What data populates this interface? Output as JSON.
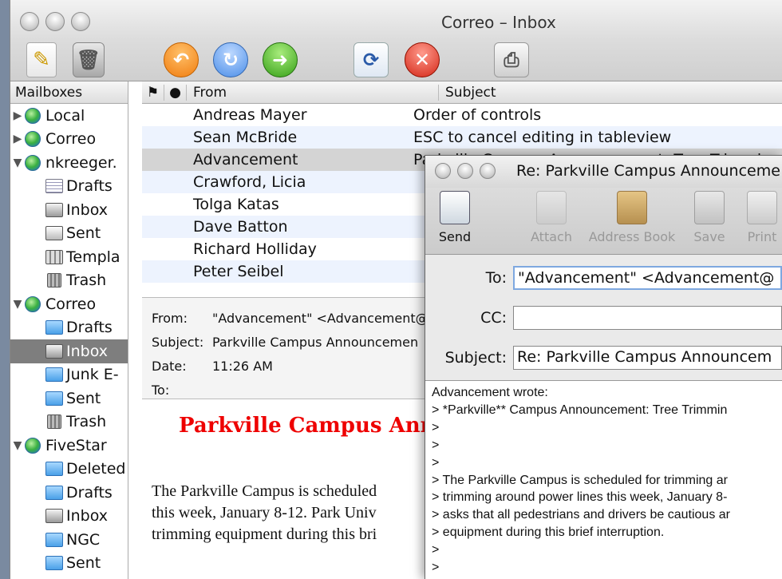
{
  "window": {
    "title": "Correo – Inbox"
  },
  "toolbar": {
    "compose_icon": "pencil-notepad-icon",
    "trash_icon": "trash-can-icon",
    "reply_icon": "reply-arrow-icon",
    "reply_all_icon": "reply-all-arrow-icon",
    "forward_icon": "forward-arrow-icon",
    "sync_icon": "sync-icon",
    "delete_icon": "delete-x-icon",
    "print_icon": "printer-icon"
  },
  "sidebar": {
    "header": "Mailboxes",
    "items": [
      {
        "label": "Local",
        "level": 0,
        "icon": "globe-icon",
        "expanded": false
      },
      {
        "label": "Correo",
        "level": 0,
        "icon": "globe-icon",
        "expanded": false
      },
      {
        "label": "nkreeger.",
        "level": 0,
        "icon": "globe-icon",
        "expanded": true
      },
      {
        "label": "Drafts",
        "level": 1,
        "icon": "drafts-icon"
      },
      {
        "label": "Inbox",
        "level": 1,
        "icon": "inbox-icon"
      },
      {
        "label": "Sent",
        "level": 1,
        "icon": "sent-icon"
      },
      {
        "label": "Templa",
        "level": 1,
        "icon": "templates-icon"
      },
      {
        "label": "Trash",
        "level": 1,
        "icon": "trash-icon"
      },
      {
        "label": "Correo",
        "level": 0,
        "icon": "globe-icon",
        "expanded": true
      },
      {
        "label": "Drafts",
        "level": 1,
        "icon": "folder-icon"
      },
      {
        "label": "Inbox",
        "level": 1,
        "icon": "inbox-icon",
        "selected": true
      },
      {
        "label": "Junk E-",
        "level": 1,
        "icon": "folder-icon"
      },
      {
        "label": "Sent",
        "level": 1,
        "icon": "folder-icon"
      },
      {
        "label": "Trash",
        "level": 1,
        "icon": "trash-icon"
      },
      {
        "label": "FiveStar",
        "level": 0,
        "icon": "globe-icon",
        "expanded": true
      },
      {
        "label": "Deleted",
        "level": 1,
        "icon": "folder-icon"
      },
      {
        "label": "Drafts",
        "level": 1,
        "icon": "folder-icon"
      },
      {
        "label": "Inbox",
        "level": 1,
        "icon": "inbox-icon"
      },
      {
        "label": "NGC",
        "level": 1,
        "icon": "folder-icon"
      },
      {
        "label": "Sent",
        "level": 1,
        "icon": "folder-icon"
      }
    ]
  },
  "message_list": {
    "columns": {
      "flag": "⚑",
      "read": "●",
      "from": "From",
      "subject": "Subject"
    },
    "rows": [
      {
        "from": "Andreas Mayer",
        "subject": "Order of controls"
      },
      {
        "from": "Sean McBride",
        "subject": "ESC to cancel editing in tableview"
      },
      {
        "from": "Advancement",
        "subject": "Parkville Campus Announcement: Tree Trimming",
        "selected": true
      },
      {
        "from": "Crawford, Licia",
        "subject": ""
      },
      {
        "from": "Tolga Katas",
        "subject": ""
      },
      {
        "from": "Dave Batton",
        "subject": ""
      },
      {
        "from": "Richard Holliday",
        "subject": ""
      },
      {
        "from": "Peter Seibel",
        "subject": ""
      }
    ]
  },
  "preview": {
    "headers": {
      "from_label": "From:",
      "from_value": "\"Advancement\" <Advancement@",
      "subject_label": "Subject:",
      "subject_value": "Parkville Campus Announcemen",
      "date_label": "Date:",
      "date_value": "11:26 AM",
      "to_label": "To:",
      "to_value": ""
    },
    "heading": "Parkville Campus Ann",
    "body": "The Parkville Campus is scheduled\nthis week, January 8-12. Park Univ\ntrimming equipment during this bri"
  },
  "reply_window": {
    "title": "Re: Parkville Campus Announceme",
    "tools": [
      {
        "label": "Send",
        "icon": "send-icon",
        "enabled": true
      },
      {
        "label": "Attach",
        "icon": "paperclip-icon",
        "enabled": false
      },
      {
        "label": "Address Book",
        "icon": "address-book-icon",
        "enabled": false
      },
      {
        "label": "Save",
        "icon": "floppy-disk-icon",
        "enabled": false
      },
      {
        "label": "Print",
        "icon": "printer-icon",
        "enabled": false
      }
    ],
    "fields": {
      "to_label": "To:",
      "to_value": "\"Advancement\" <Advancement@",
      "cc_label": "CC:",
      "cc_value": "",
      "subject_label": "Subject:",
      "subject_value": "Re: Parkville Campus Announcem"
    },
    "body": "Advancement wrote:\n> *Parkville** Campus Announcement: Tree Trimmin\n>\n>\n>\n> The Parkville Campus is scheduled for trimming ar\n> trimming around power lines this week, January 8-\n> asks that all pedestrians and drivers be cautious ar\n> equipment during this brief interruption.\n>\n>"
  }
}
